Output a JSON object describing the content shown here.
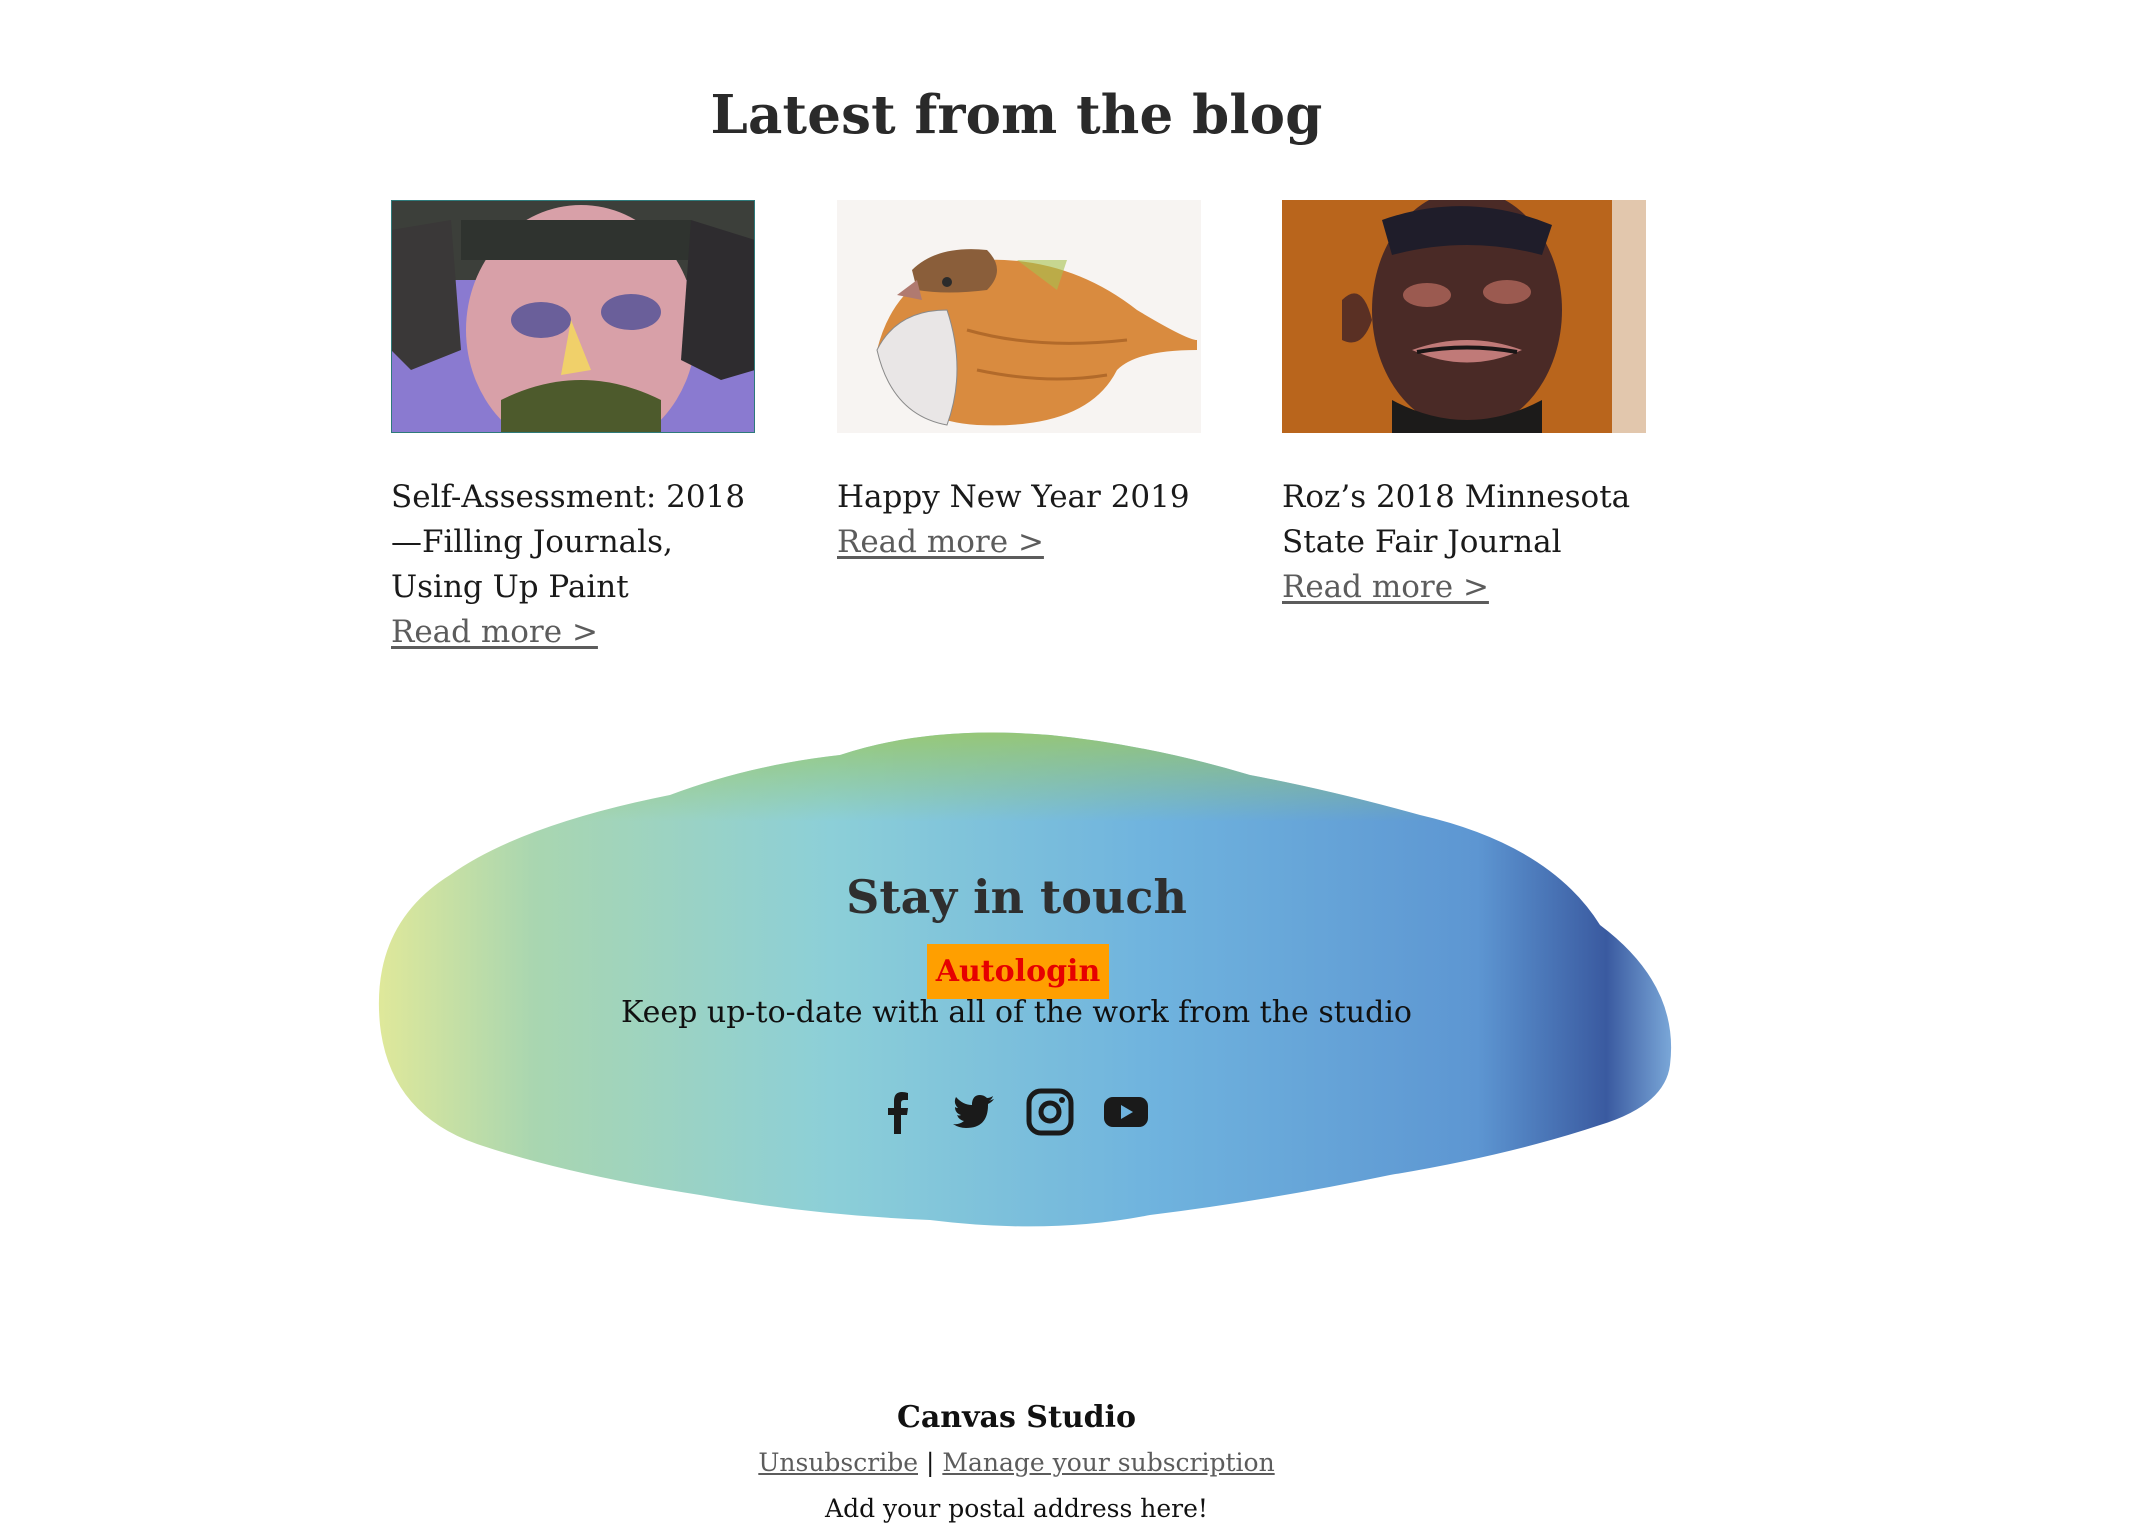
{
  "blog": {
    "heading": "Latest from the blog",
    "posts": [
      {
        "title": "Self-Assessment: 2018—Filling Journals, Using Up Paint",
        "link": "Read more >"
      },
      {
        "title": "Happy New Year 2019",
        "link": "Read more >"
      },
      {
        "title": "Roz’s 2018 Minnesota State Fair Journal",
        "link": "Read more >"
      }
    ]
  },
  "stay_in_touch": {
    "heading": "Stay in touch",
    "autologin_label": "Autologin",
    "text": "Keep up-to-date with all of the work from the studio",
    "social_icons": [
      "facebook-icon",
      "twitter-icon",
      "instagram-icon",
      "youtube-icon"
    ]
  },
  "footer": {
    "name": "Canvas Studio",
    "unsubscribe": "Unsubscribe",
    "separator": "|",
    "manage": "Manage your subscription",
    "address": "Add your postal address here!"
  },
  "colors": {
    "autologin_bg": "#ff9f00",
    "autologin_text": "#e60000",
    "link": "#5c5c5c",
    "splash_blue": "#6aaed4",
    "splash_green": "#a9cf72"
  }
}
